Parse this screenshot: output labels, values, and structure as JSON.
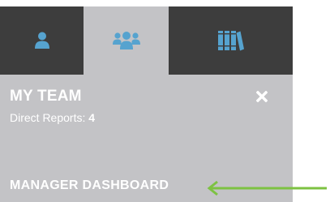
{
  "tabs": [
    {
      "id": "my-profile",
      "icon": "person-icon",
      "active": false
    },
    {
      "id": "my-team",
      "icon": "team-icon",
      "active": true
    },
    {
      "id": "library",
      "icon": "books-icon",
      "active": false
    }
  ],
  "panel": {
    "title": "MY TEAM",
    "direct_reports_label": "Direct Reports:",
    "direct_reports_count": "4",
    "close_icon": "close-icon",
    "dashboard_link": "MANAGER DASHBOARD"
  },
  "annotation": {
    "arrow_icon": "left-arrow-icon",
    "arrow_color": "#7dc242"
  },
  "colors": {
    "tab_dark": "#3d3d3d",
    "tab_active": "#c3c3c6",
    "icon_blue": "#56a3cf",
    "panel_bg": "#c3c3c6",
    "text": "#ffffff"
  }
}
